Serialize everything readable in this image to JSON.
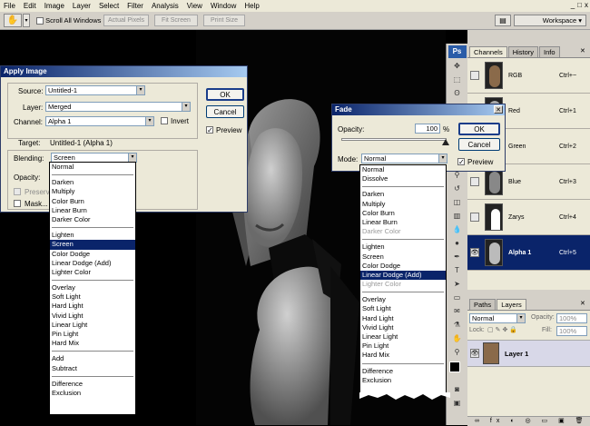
{
  "menu": [
    "File",
    "Edit",
    "Image",
    "Layer",
    "Select",
    "Filter",
    "Analysis",
    "View",
    "Window",
    "Help"
  ],
  "window_controls": [
    "_",
    "□",
    "x"
  ],
  "options_bar": {
    "scroll_all_windows": "Scroll All Windows",
    "actual_pixels": "Actual Pixels",
    "fit_screen": "Fit Screen",
    "print_size": "Print Size",
    "workspace": "Workspace"
  },
  "apply_image": {
    "title": "Apply Image",
    "source_label": "Source:",
    "source_value": "Untitled-1",
    "layer_label": "Layer:",
    "layer_value": "Merged",
    "channel_label": "Channel:",
    "channel_value": "Alpha 1",
    "invert_label": "Invert",
    "target_label": "Target:",
    "target_value": "Untitled-1 (Alpha 1)",
    "blending_label": "Blending:",
    "blending_value": "Screen",
    "opacity_label": "Opacity:",
    "preserve_label": "Preserve",
    "mask_label": "Mask...",
    "ok": "OK",
    "cancel": "Cancel",
    "preview": "Preview",
    "blend_options": [
      [
        "Normal"
      ],
      [
        "Darken",
        "Multiply",
        "Color Burn",
        "Linear Burn",
        "Darker Color"
      ],
      [
        "Lighten",
        "Screen",
        "Color Dodge",
        "Linear Dodge (Add)",
        "Lighter Color"
      ],
      [
        "Overlay",
        "Soft Light",
        "Hard Light",
        "Vivid Light",
        "Linear Light",
        "Pin Light",
        "Hard Mix"
      ],
      [
        "Add",
        "Subtract"
      ],
      [
        "Difference",
        "Exclusion"
      ]
    ],
    "selected_option": "Screen"
  },
  "fade": {
    "title": "Fade",
    "opacity_label": "Opacity:",
    "opacity_value": "100",
    "percent": "%",
    "mode_label": "Mode:",
    "mode_value": "Normal",
    "ok": "OK",
    "cancel": "Cancel",
    "preview": "Preview",
    "mode_options": [
      [
        "Normal",
        "Dissolve"
      ],
      [
        "Darken",
        "Multiply",
        "Color Burn",
        "Linear Burn",
        "Darker Color"
      ],
      [
        "Lighten",
        "Screen",
        "Color Dodge",
        "Linear Dodge (Add)",
        "Lighter Color"
      ],
      [
        "Overlay",
        "Soft Light",
        "Hard Light",
        "Vivid Light",
        "Linear Light",
        "Pin Light",
        "Hard Mix"
      ],
      [
        "Difference",
        "Exclusion"
      ]
    ],
    "selected_option": "Linear Dodge (Add)",
    "disabled_options": [
      "Darker Color",
      "Lighter Color"
    ]
  },
  "channels_panel": {
    "tabs": [
      "Channels",
      "History",
      "Info"
    ],
    "rows": [
      {
        "name": "RGB",
        "key": "Ctrl+~"
      },
      {
        "name": "Red",
        "key": "Ctrl+1"
      },
      {
        "name": "Green",
        "key": "Ctrl+2"
      },
      {
        "name": "Blue",
        "key": "Ctrl+3"
      },
      {
        "name": "Zarys",
        "key": "Ctrl+4"
      },
      {
        "name": "Alpha 1",
        "key": "Ctrl+5"
      }
    ]
  },
  "layers_panel": {
    "tabs": [
      "Paths",
      "Layers"
    ],
    "blend_mode": "Normal",
    "opacity_label": "Opacity:",
    "opacity_value": "100%",
    "lock_label": "Lock:",
    "fill_label": "Fill:",
    "fill_value": "100%",
    "layer_name": "Layer 1"
  },
  "toolbox_logo": "Ps"
}
